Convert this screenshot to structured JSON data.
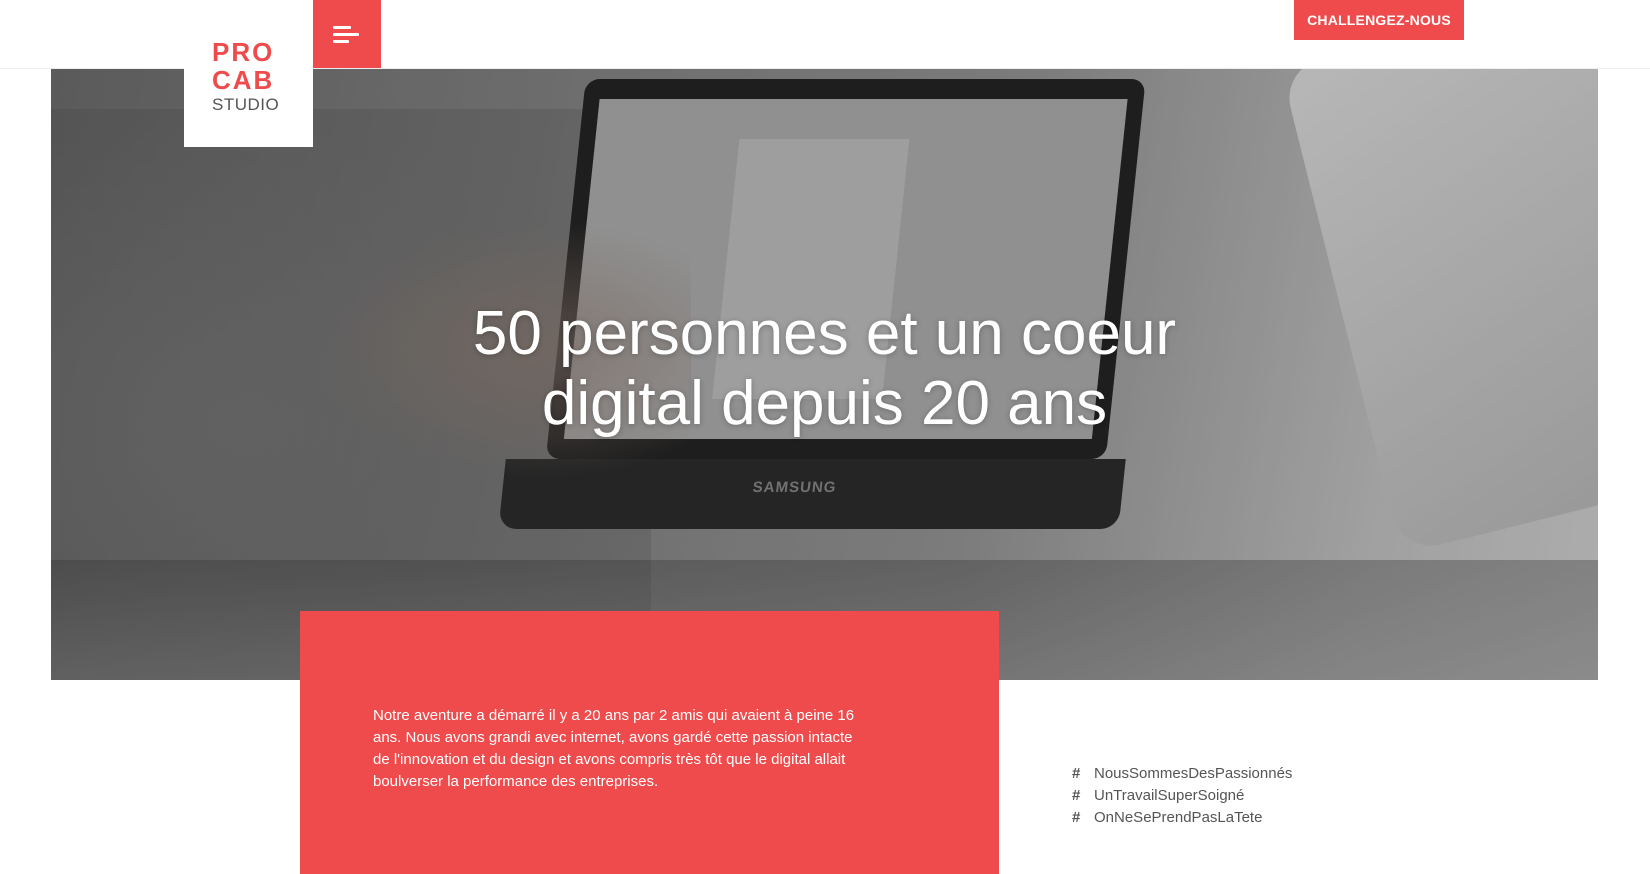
{
  "brand": {
    "logo_line1": "PRO",
    "logo_line2": "CAB",
    "logo_line3": "STUDIO",
    "accent_color": "#ef4b4c"
  },
  "header": {
    "menu_icon": "hamburger-icon",
    "cta_label": "CHALLENGEZ-NOUS"
  },
  "hero": {
    "title_line1": "50 personnes et un coeur",
    "title_line2": "digital depuis 20 ans",
    "laptop_brand": "SAMSUNG"
  },
  "about": {
    "text": "Notre aventure a démarré il y a 20 ans par 2 amis qui avaient à peine 16 ans. Nous avons grandi avec internet, avons gardé cette passion intacte de l'innovation et du design et avons compris très tôt que le digital allait boulverser la performance des entreprises."
  },
  "hashtags": [
    {
      "symbol": "#",
      "label": "NousSommesDesPassionnés"
    },
    {
      "symbol": "#",
      "label": "UnTravailSuperSoigné"
    },
    {
      "symbol": "#",
      "label": "OnNeSePrendPasLaTete"
    }
  ]
}
